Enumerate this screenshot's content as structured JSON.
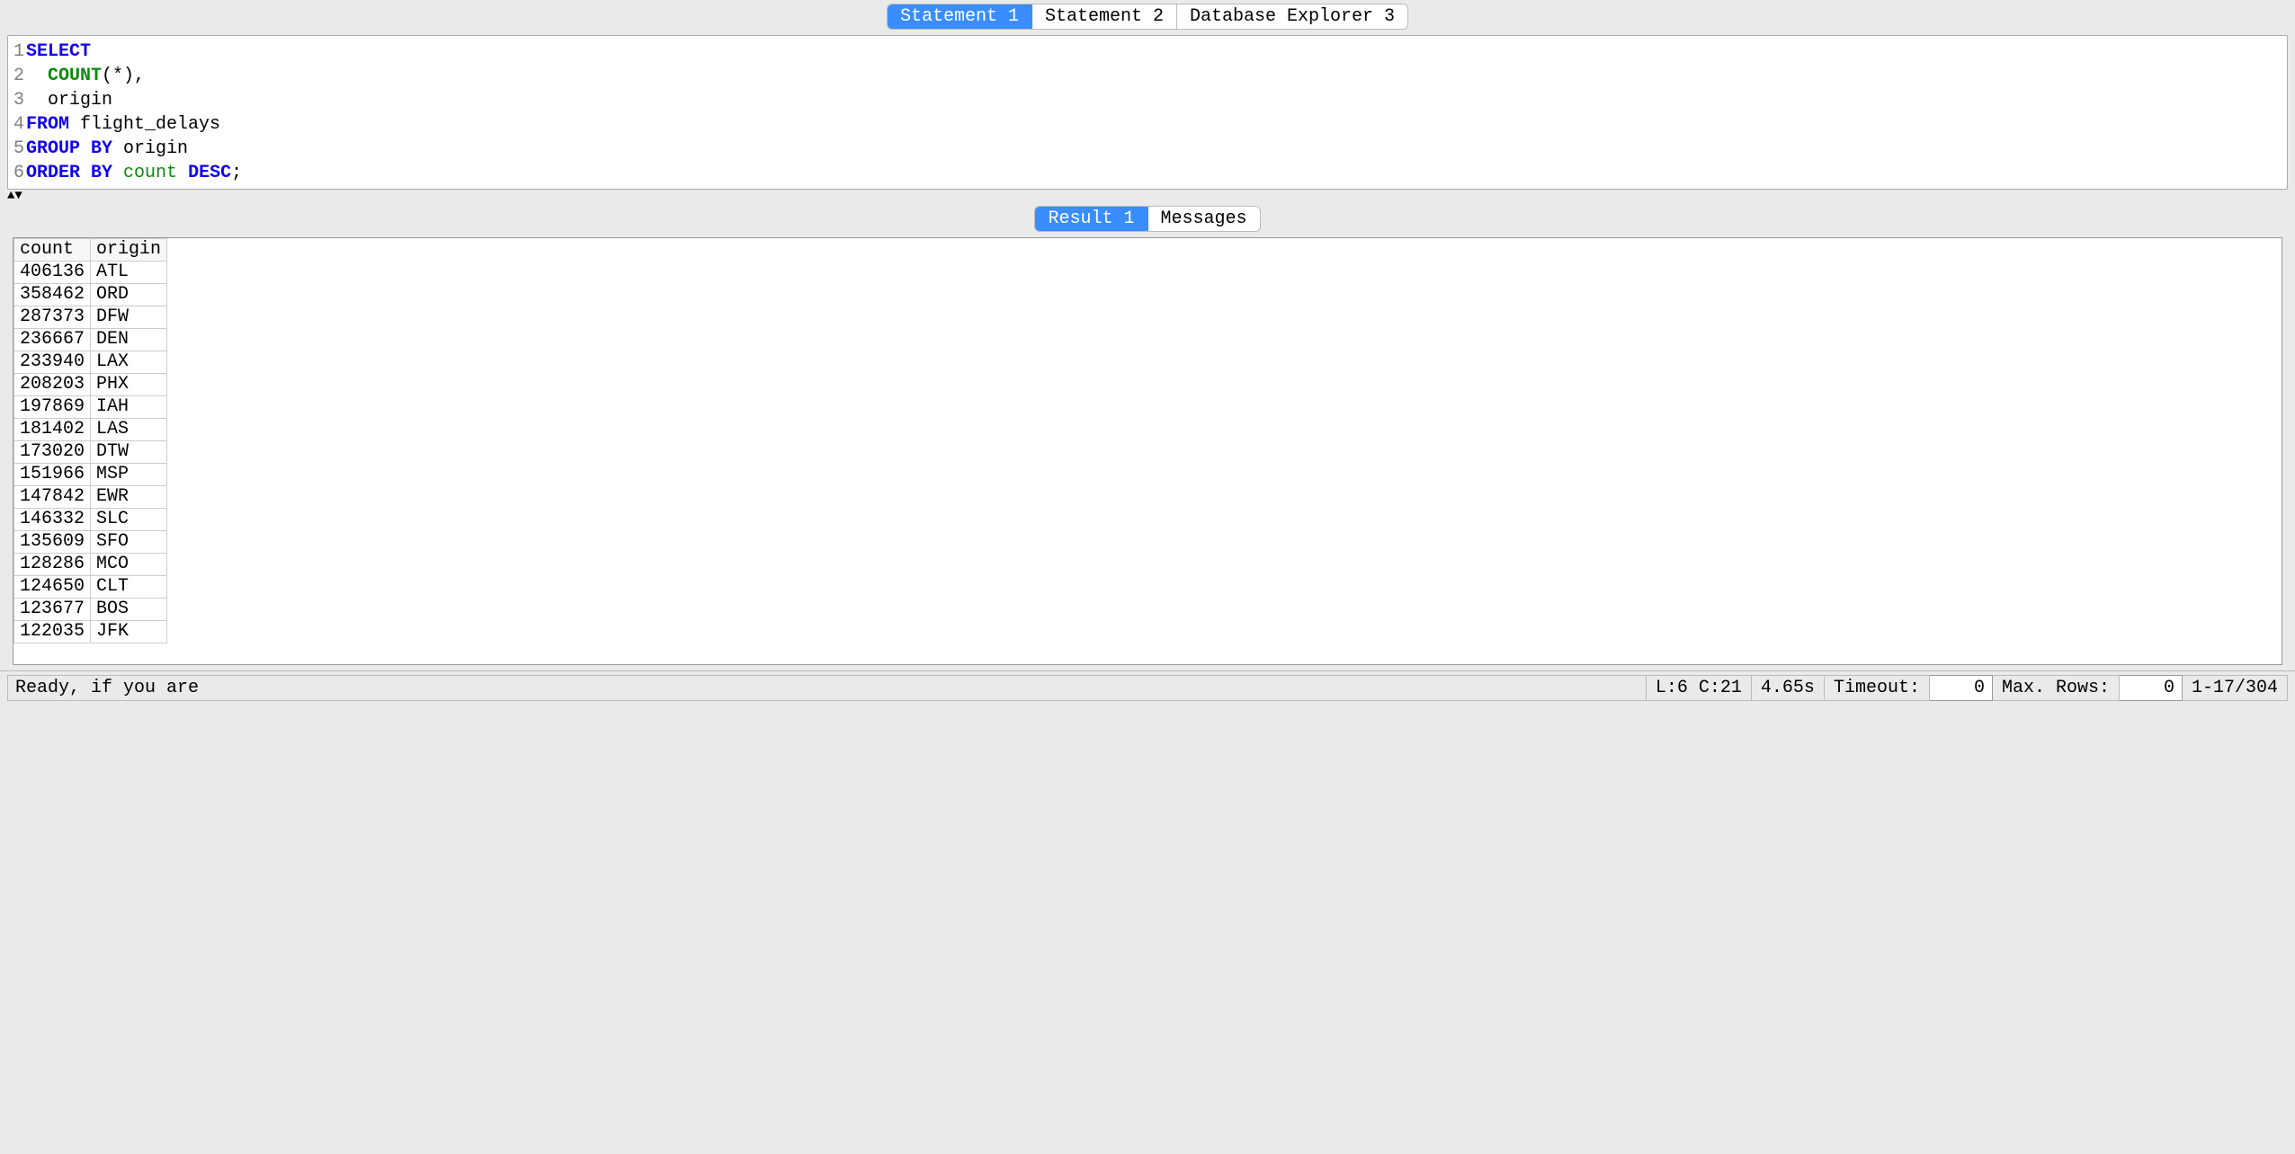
{
  "tabs": {
    "items": [
      "Statement 1",
      "Statement 2",
      "Database Explorer 3"
    ],
    "active_index": 0
  },
  "editor": {
    "lines": [
      [
        {
          "t": "SELECT",
          "c": "kw"
        }
      ],
      [
        {
          "t": "  ",
          "c": "plain"
        },
        {
          "t": "COUNT",
          "c": "fn"
        },
        {
          "t": "(*),",
          "c": "plain"
        }
      ],
      [
        {
          "t": "  origin",
          "c": "plain"
        }
      ],
      [
        {
          "t": "FROM",
          "c": "kw"
        },
        {
          "t": " flight_delays",
          "c": "plain"
        }
      ],
      [
        {
          "t": "GROUP BY",
          "c": "kw"
        },
        {
          "t": " origin",
          "c": "plain"
        }
      ],
      [
        {
          "t": "ORDER BY",
          "c": "kw"
        },
        {
          "t": " ",
          "c": "plain"
        },
        {
          "t": "count",
          "c": "id"
        },
        {
          "t": " ",
          "c": "plain"
        },
        {
          "t": "DESC",
          "c": "kw"
        },
        {
          "t": ";",
          "c": "plain"
        }
      ]
    ]
  },
  "result_tabs": {
    "items": [
      "Result 1",
      "Messages"
    ],
    "active_index": 0
  },
  "result": {
    "columns": [
      "count",
      "origin"
    ],
    "rows": [
      {
        "count": "406136",
        "origin": "ATL"
      },
      {
        "count": "358462",
        "origin": "ORD"
      },
      {
        "count": "287373",
        "origin": "DFW"
      },
      {
        "count": "236667",
        "origin": "DEN"
      },
      {
        "count": "233940",
        "origin": "LAX"
      },
      {
        "count": "208203",
        "origin": "PHX"
      },
      {
        "count": "197869",
        "origin": "IAH"
      },
      {
        "count": "181402",
        "origin": "LAS"
      },
      {
        "count": "173020",
        "origin": "DTW"
      },
      {
        "count": "151966",
        "origin": "MSP"
      },
      {
        "count": "147842",
        "origin": "EWR"
      },
      {
        "count": "146332",
        "origin": "SLC"
      },
      {
        "count": "135609",
        "origin": "SFO"
      },
      {
        "count": "128286",
        "origin": "MCO"
      },
      {
        "count": "124650",
        "origin": "CLT"
      },
      {
        "count": "123677",
        "origin": "BOS"
      },
      {
        "count": "122035",
        "origin": "JFK"
      }
    ]
  },
  "status": {
    "ready": "Ready, if you are",
    "cursor": "L:6 C:21",
    "elapsed": "4.65s",
    "timeout_label": "Timeout:",
    "timeout_value": "0",
    "maxrows_label": "Max. Rows:",
    "maxrows_value": "0",
    "range": "1-17/304"
  }
}
